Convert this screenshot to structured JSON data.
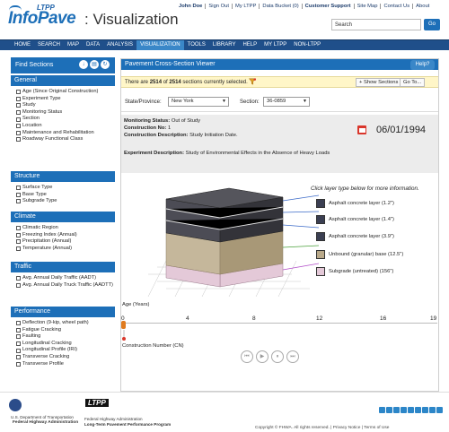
{
  "header": {
    "logo_ltpp": "LTPP",
    "logo_infopave": "InfoPave",
    "logo_subtitle": ": Visualization",
    "toplinks": [
      "John Doe",
      "Sign Out",
      "My LTPP",
      "Data Bucket (0)",
      "Customer Support",
      "Site Map",
      "Contact Us",
      "About"
    ],
    "search_placeholder": "Search",
    "search_button": "Go"
  },
  "nav": {
    "tabs": [
      "HOME",
      "SEARCH",
      "MAP",
      "DATA",
      "ANALYSIS",
      "VISUALIZATION",
      "TOOLS",
      "LIBRARY",
      "HELP",
      "MY LTPP",
      "NON-LTPP"
    ],
    "active": "VISUALIZATION"
  },
  "sidebar": {
    "title": "Find Sections",
    "sections": [
      {
        "title": "General",
        "items": [
          "Age (Since Original Construction)",
          "Experiment Type",
          "Study",
          "Monitoring Status",
          "Section",
          "Location",
          "Maintenance and Rehabilitation",
          "Roadway Functional Class"
        ]
      },
      {
        "title": "Structure",
        "items": [
          "Surface Type",
          "Base Type",
          "Subgrade Type"
        ]
      },
      {
        "title": "Climate",
        "items": [
          "Climatic Region",
          "Freezing Index (Annual)",
          "Precipitation (Annual)",
          "Temperature (Annual)"
        ]
      },
      {
        "title": "Traffic",
        "items": [
          "Avg. Annual Daily Traffic (AADT)",
          "Avg. Annual Daily Truck Traffic (AADTT)"
        ]
      },
      {
        "title": "Performance",
        "items": [
          "Deflection (9-kip, wheel path)",
          "Fatigue Cracking",
          "Faulting",
          "Longitudinal Cracking",
          "Longitudinal Profile (IRI)",
          "Transverse Cracking",
          "Transverse Profile"
        ]
      }
    ]
  },
  "main": {
    "title": "Pavement Cross-Section Viewer",
    "help": "Help?",
    "notice_prefix": "There are ",
    "notice_selected": "2514",
    "notice_mid": " of ",
    "notice_total": "2514",
    "notice_suffix": " sections currently selected.",
    "show_sections": "+ Show Sections",
    "goto": "Go To...",
    "state_label": "State/Province:",
    "state_value": "New York",
    "section_label": "Section:",
    "section_value": "36-0859",
    "monitoring_status_label": "Monitoring Status:",
    "monitoring_status_value": "Out of Study",
    "construction_no_label": "Construction No:",
    "construction_no_value": "1",
    "construction_desc_label": "Construction Description:",
    "construction_desc_value": "Study Initiation Date.",
    "experiment_desc_label": "Experiment Description:",
    "experiment_desc_value": "Study of Environmental Effects in the Absence of Heavy Loads",
    "date": "06/01/1994",
    "layer_hint": "Click layer type below for more information.",
    "layers": [
      {
        "label": "Asphalt concrete layer (1.2\")",
        "color": "#3b3f52"
      },
      {
        "label": "Asphalt concrete layer (1.4\")",
        "color": "#3b3f52"
      },
      {
        "label": "Asphalt concrete layer (3.9\")",
        "color": "#3b3f52"
      },
      {
        "label": "Unbound (granular) base (12.5\")",
        "color": "#b9a98a"
      },
      {
        "label": "Subgrade (untreated) (156\")",
        "color": "#e4c9d8"
      }
    ],
    "age_label": "Age (Years)",
    "ticks": [
      "0",
      "4",
      "8",
      "12",
      "16",
      "19"
    ],
    "construction_number_label": "Construction Number (CN)"
  },
  "footer": {
    "dot": "U.S. Department of Transportation",
    "fhwa": "Federal Highway Administration",
    "ltpp_badge": "LTPP",
    "fhwa2": "Federal Highway Administration",
    "ltpp_program": "Long-Term Pavement Performance Program",
    "copyright": "Copyright © FHWA.  All rights reserved.  |  Privacy Notice  |  Terms of Use"
  }
}
